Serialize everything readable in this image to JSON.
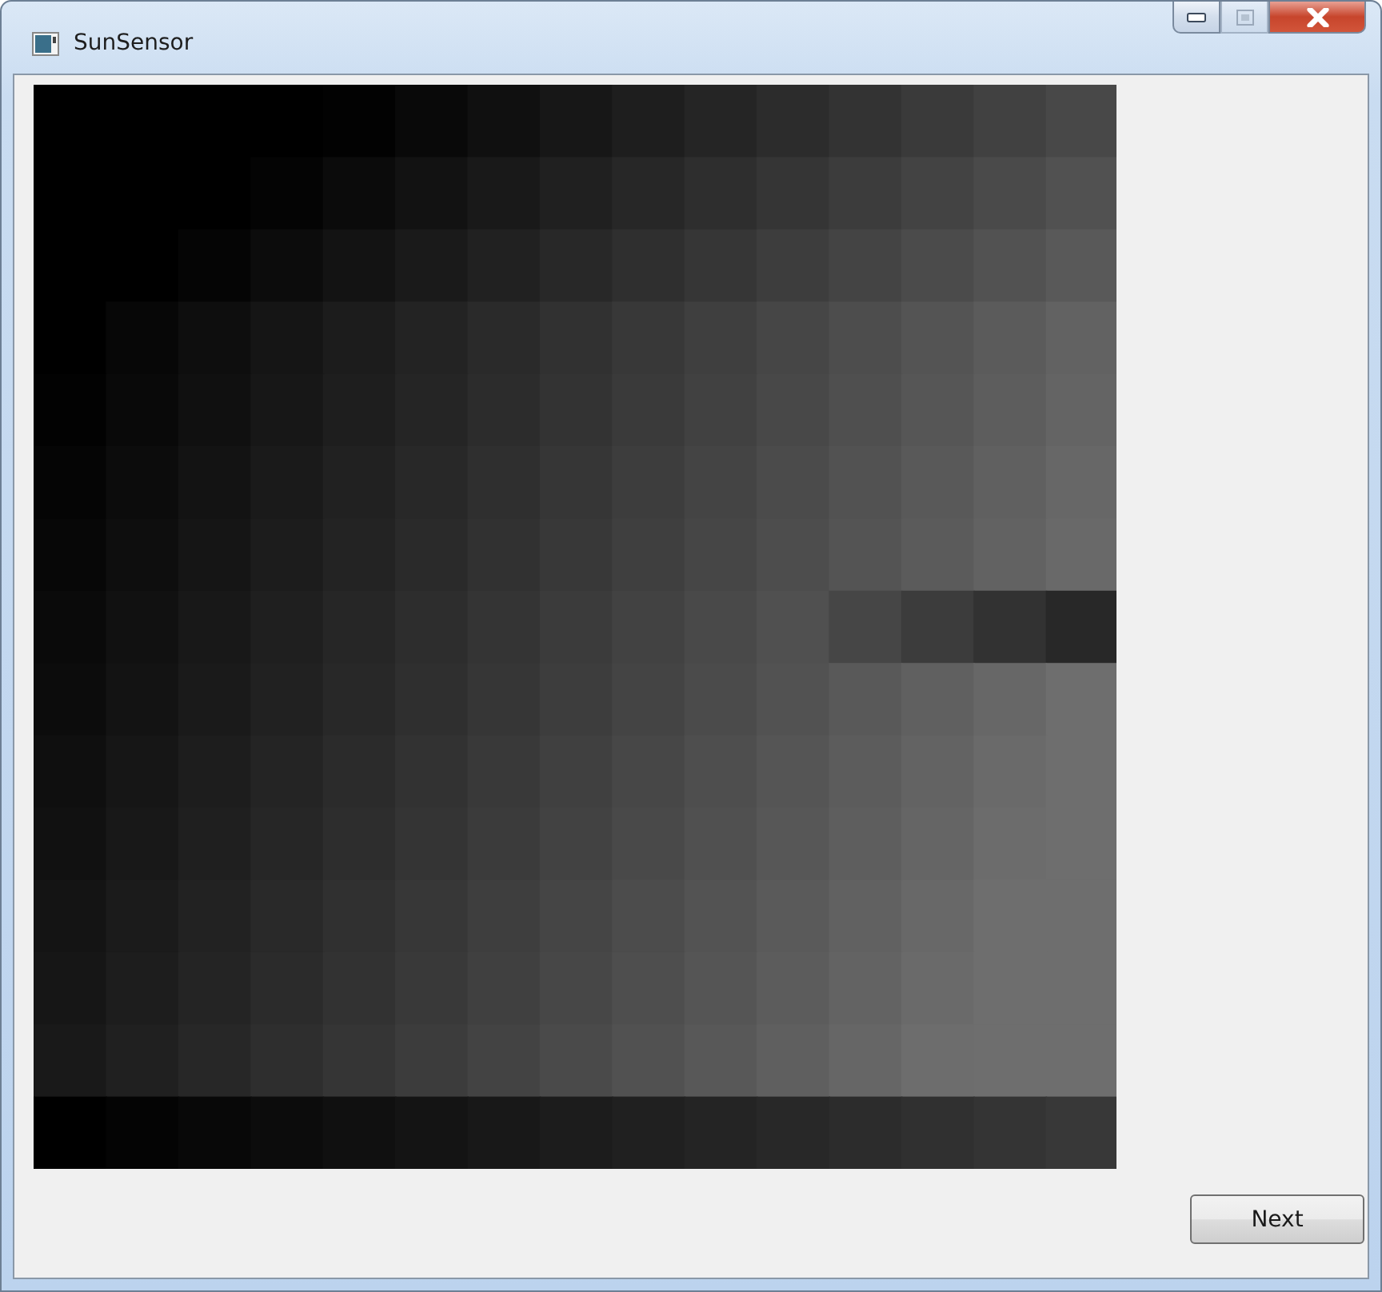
{
  "window": {
    "title": "SunSensor"
  },
  "caption_buttons": [
    {
      "kind": "minimize",
      "disabled": false
    },
    {
      "kind": "maximize",
      "disabled": true
    },
    {
      "kind": "close",
      "disabled": false
    }
  ],
  "buttons": [
    {
      "label": "Next"
    }
  ]
}
